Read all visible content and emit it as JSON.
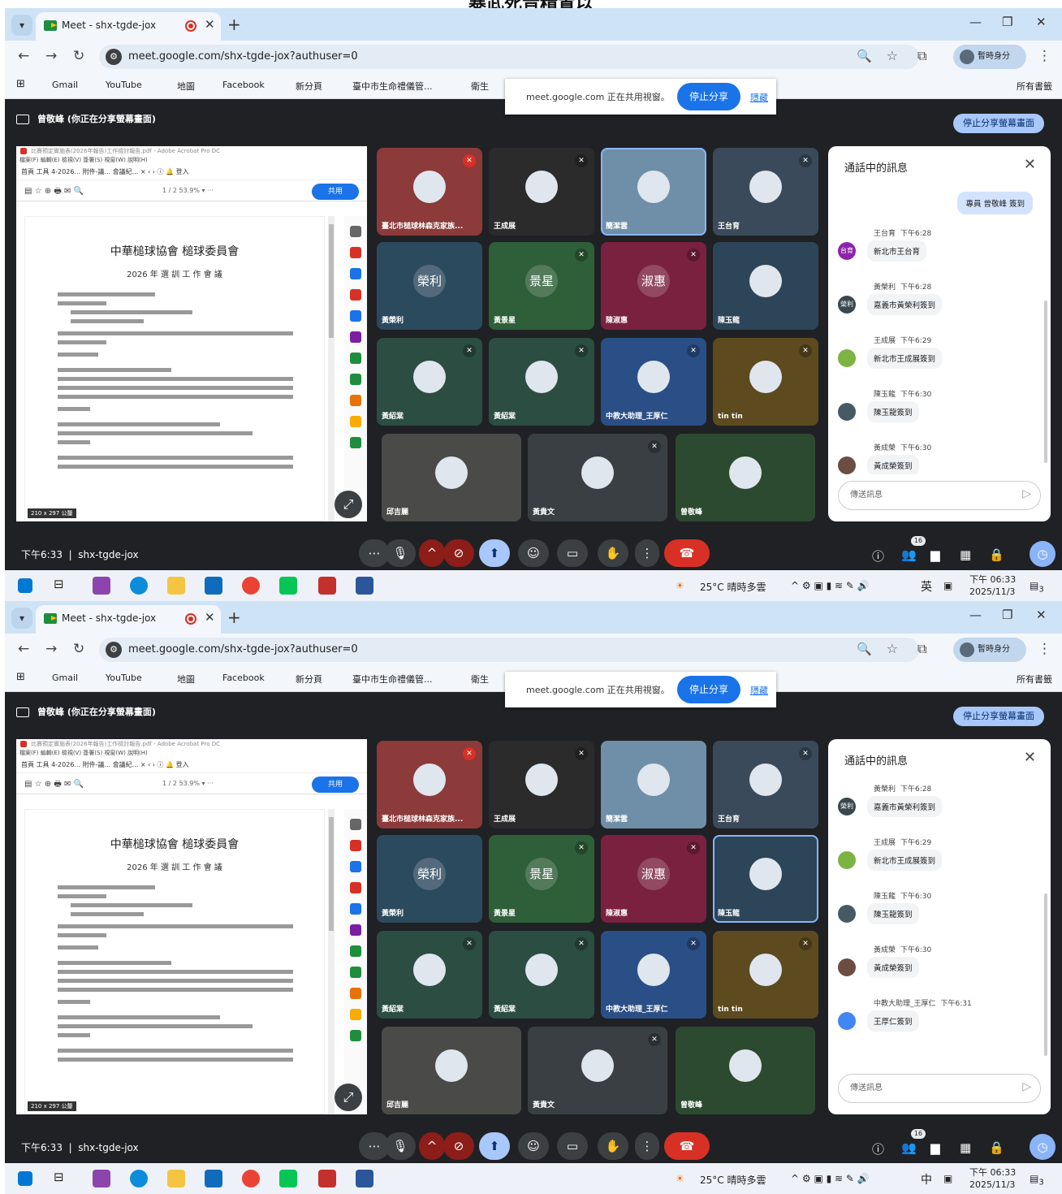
{
  "page_title": "暴武死音精置以",
  "browser": {
    "tab_title": "Meet - shx-tgde-jox",
    "url": "meet.google.com/shx-tgde-jox?authuser=0",
    "profile": "暫時身分",
    "bookmarks": [
      "Gmail",
      "YouTube",
      "地圖",
      "Facebook",
      "新分頁",
      "臺中市生命禮儀管...",
      "衛生"
    ],
    "all_bookmarks": "所有書籤"
  },
  "share_popup": {
    "text": "meet.google.com 正在共用視窗。",
    "stop": "停止分享",
    "hide": "隱藏"
  },
  "presenting": "曾敬峰 (你正在分享螢幕畫面)",
  "stop_share_screen": "停止分享螢幕畫面",
  "doc": {
    "app": "比賽預定實施表(2026年報告)工作檢討報告.pdf - Adobe Acrobat Pro DC",
    "menu": "檔案(F)  編輯(E)  檢視(V)  簽署(S)  視窗(W)  說明(H)",
    "tabs": "首頁   工具   4-2026...   附件-議...   會議紀...  ×   ‹  ›   ⓘ   🔔   登入",
    "share": "共用",
    "zoom": "1 / 2     53.9%  ▾   ···",
    "title": "中華槌球協會  槌球委員會",
    "subtitle": "2026 年 選 訓 工 作 會 議",
    "size": "210 x 297 公釐"
  },
  "chat": {
    "title": "通話中的訊息",
    "placeholder": "傳送訊息",
    "my_msg": "專員 曾敬峰 簽到"
  },
  "time": "下午6:33",
  "meeting_code": "shx-tgde-jox",
  "people_count": "16",
  "taskbar": {
    "weather": "25°C 晴時多雲",
    "clock_time": "下午 06:33",
    "clock_date": "2025/11/3",
    "notif": "3"
  },
  "screens": [
    {
      "ime": "英",
      "chat_messages": [
        {
          "name": "王台育",
          "time": "下午6:28",
          "text": "新北市王台育",
          "initial": "台育",
          "color": "#8e24aa"
        },
        {
          "name": "黃榮利",
          "time": "下午6:28",
          "text": "嘉義市黃榮利簽到",
          "initial": "榮利",
          "color": "#37474f"
        },
        {
          "name": "王成展",
          "time": "下午6:29",
          "text": "新北市王成展簽到",
          "initial": "",
          "color": "#7cb342"
        },
        {
          "name": "陳玉龍",
          "time": "下午6:30",
          "text": "陳玉龍簽到",
          "initial": "",
          "color": "#455a64"
        },
        {
          "name": "黃成榮",
          "time": "下午6:30",
          "text": "黃成榮簽到",
          "initial": "",
          "color": "#6d4c41"
        }
      ]
    },
    {
      "ime": "中",
      "chat_messages": [
        {
          "name": "黃榮利",
          "time": "下午6:28",
          "text": "嘉義市黃榮利簽到",
          "initial": "榮利",
          "color": "#37474f"
        },
        {
          "name": "王成展",
          "time": "下午6:29",
          "text": "新北市王成展簽到",
          "initial": "",
          "color": "#7cb342"
        },
        {
          "name": "陳玉龍",
          "time": "下午6:30",
          "text": "陳玉龍簽到",
          "initial": "",
          "color": "#455a64"
        },
        {
          "name": "黃成榮",
          "time": "下午6:30",
          "text": "黃成榮簽到",
          "initial": "",
          "color": "#6d4c41"
        },
        {
          "name": "中教大助理_王厚仁",
          "time": "下午6:31",
          "text": "王厚仁簽到",
          "initial": "",
          "color": "#4285f4"
        }
      ]
    }
  ],
  "tiles": [
    {
      "name": "臺北市槌球林森克家族...",
      "bg": "#8c3a3a",
      "avatar": "",
      "mic": "red"
    },
    {
      "name": "王成展",
      "bg": "#2b2b2b",
      "avatar": "",
      "mic": "muted"
    },
    {
      "name": "簡潔雲",
      "bg": "#6f8fa8",
      "avatar": "",
      "mic": ""
    },
    {
      "name": "王台育",
      "bg": "#3a4a5a",
      "avatar": "",
      "mic": "muted"
    },
    {
      "name": "黃榮利",
      "bg": "#2c4a5e",
      "avatar": "榮利",
      "mic": ""
    },
    {
      "name": "黃景星",
      "bg": "#2e5f38",
      "avatar": "景星",
      "mic": "muted"
    },
    {
      "name": "陳淑惠",
      "bg": "#7a2140",
      "avatar": "淑惠",
      "mic": "muted"
    },
    {
      "name": "陳玉龍",
      "bg": "#2c4558",
      "avatar": "",
      "mic": ""
    },
    {
      "name": "黃紹棠",
      "bg": "#2b4d42",
      "avatar": "",
      "mic": "muted"
    },
    {
      "name": "黃紹棠",
      "bg": "#2b4d42",
      "avatar": "",
      "mic": "muted"
    },
    {
      "name": "中教大助理_王厚仁",
      "bg": "#2a4f86",
      "avatar": "",
      "mic": "muted"
    },
    {
      "name": "tin tin",
      "bg": "#5d4a1f",
      "avatar": "",
      "mic": "muted"
    },
    {
      "name": "邱吉麗",
      "bg": "#4a4a48",
      "avatar": "",
      "mic": ""
    },
    {
      "name": "黃貴文",
      "bg": "#3a3f44",
      "avatar": "",
      "mic": "muted"
    },
    {
      "name": "曾敬峰",
      "bg": "#2c4a30",
      "avatar": "",
      "mic": ""
    }
  ]
}
